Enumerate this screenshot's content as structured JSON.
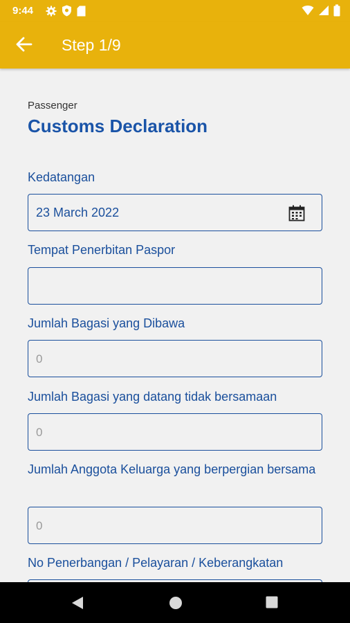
{
  "status_bar": {
    "time": "9:44",
    "left_icons": [
      "gear-icon",
      "shield-icon",
      "sd-card-icon"
    ],
    "right_icons": [
      "wifi-icon",
      "cellular-signal-icon",
      "battery-icon"
    ]
  },
  "app_bar": {
    "title": "Step 1/9",
    "back_icon": "arrow-left-icon",
    "color": "#e8b20c"
  },
  "form": {
    "subtitle": "Passenger",
    "title": "Customs Declaration",
    "fields": [
      {
        "label": "Kedatangan",
        "value": "23 March 2022",
        "icon": "calendar-icon"
      },
      {
        "label": "Tempat Penerbitan Paspor",
        "value": ""
      },
      {
        "label": "Jumlah Bagasi yang Dibawa",
        "placeholder": "0"
      },
      {
        "label": "Jumlah Bagasi yang datang tidak bersamaan",
        "placeholder": "0"
      },
      {
        "label": "Jumlah Anggota Keluarga yang berpergian bersama",
        "placeholder": "0"
      },
      {
        "label": "No Penerbangan / Pelayaran / Keberangkatan",
        "value": ""
      }
    ],
    "accent_color": "#1a4f9c"
  },
  "nav_bar": {
    "buttons": [
      "back-triangle-icon",
      "home-circle-icon",
      "recents-square-icon"
    ]
  }
}
